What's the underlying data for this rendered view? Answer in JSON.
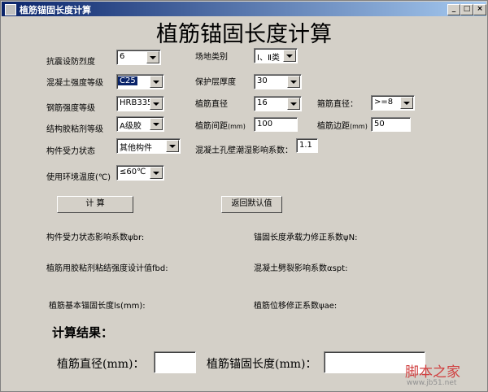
{
  "window": {
    "title": "植筋锚固长度计算"
  },
  "heading": "植筋锚固长度计算",
  "fields": {
    "seismic": {
      "label": "抗震设防烈度",
      "value": "6"
    },
    "site": {
      "label": "场地类别",
      "value": "Ⅰ、Ⅱ类"
    },
    "concrete": {
      "label": "混凝土强度等级",
      "value": "C25"
    },
    "cover": {
      "label": "保护层厚度",
      "value": "30"
    },
    "rebar_grade": {
      "label": "钢筋强度等级",
      "value": "HRB335"
    },
    "rebar_dia": {
      "label": "植筋直径",
      "value": "16"
    },
    "stirrup_dia": {
      "label": "箍筋直径：",
      "value": ">=8"
    },
    "adhesive": {
      "label": "结构胶粘剂等级",
      "value": "A级胶"
    },
    "spacing": {
      "label": "植筋间距",
      "unit": "(mm)",
      "value": "100"
    },
    "edge": {
      "label": "植筋边距",
      "unit": "(mm)",
      "value": "50"
    },
    "member": {
      "label": "构件受力状态",
      "value": "其他构件"
    },
    "hole_factor": {
      "label": "混凝土孔壁潮湿影响系数：",
      "value": "1.1"
    },
    "temp": {
      "label": "使用环境温度(℃)",
      "value": "≤60℃"
    }
  },
  "buttons": {
    "calc": "计  算",
    "reset": "返回默认值"
  },
  "outputs": {
    "psi_br": "构件受力状态影响系数ψbr:",
    "psi_n": "锚固长度承载力修正系数ψN:",
    "fbd": "植筋用胶粘剂粘结强度设计值fbd:",
    "acr": "混凝土劈裂影响系数αspt:",
    "ls": "植筋基本锚固长度ls(mm):",
    "psi_ae": "植筋位移修正系数ψae:"
  },
  "result": {
    "title": "计算结果：",
    "dia_label": "植筋直径(mm)：",
    "dia_value": "",
    "len_label": "植筋锚固长度(mm)：",
    "len_value": ""
  },
  "watermark": {
    "text": "脚本之家",
    "url": "www.jb51.net"
  }
}
